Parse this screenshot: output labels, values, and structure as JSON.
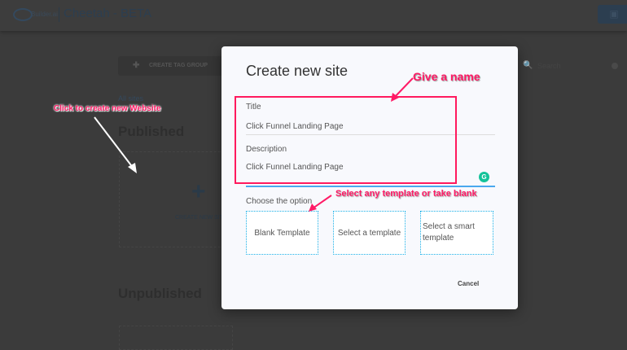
{
  "header": {
    "logo_text": "Builder.ai",
    "app_title": "Cheetah - BETA",
    "top_button_icon": "document-info-icon"
  },
  "background": {
    "create_tag_group": "CREATE TAG GROUP",
    "all_sites": "All sites",
    "published": "Published",
    "create_new_site": "CREATE NEW SITE",
    "unpublished": "Unpublished",
    "search_placeholder": "Search"
  },
  "modal": {
    "title": "Create new site",
    "title_label": "Title",
    "title_value": "Click Funnel Landing Page",
    "description_label": "Description",
    "description_value": "Click Funnel Landing Page",
    "choose_label": "Choose the option",
    "options": [
      "Blank Template",
      "Select a template",
      "Select a smart template"
    ],
    "cancel": "Cancel"
  },
  "annotations": {
    "create": "Click to create new Website",
    "name": "Give a name",
    "template": "Select any template or take blank"
  },
  "colors": {
    "annotation": "#ff1a66",
    "option_border": "#1ab0e8",
    "accent": "#2c3e50"
  }
}
